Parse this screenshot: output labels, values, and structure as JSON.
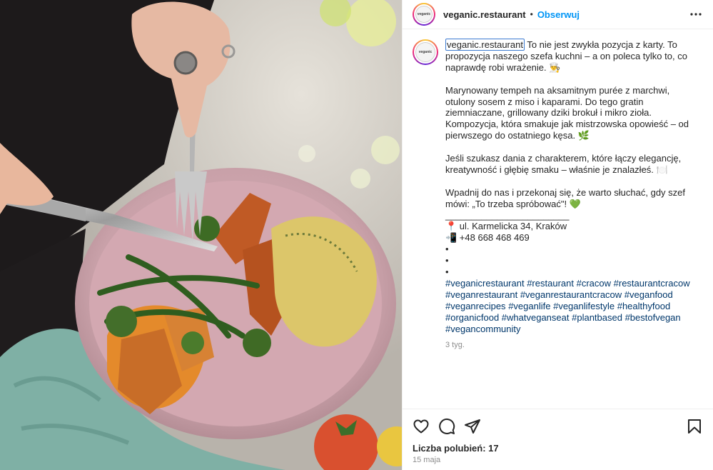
{
  "header": {
    "username": "veganic.restaurant",
    "separator": "•",
    "follow_label": "Obserwuj",
    "avatar_text": "veganic",
    "more_icon": "more-dots-icon"
  },
  "caption": {
    "username": "veganic.restaurant",
    "intro": " To nie jest zwykła pozycja z karty. To propozycja naszego szefa kuchni – a on poleca tylko to, co naprawdę robi wrażenie. 👨‍🍳",
    "para2": "Marynowany tempeh na aksamitnym purée z marchwi, otulony sosem z miso i kaparami. Do tego gratin ziemniaczane, grillowany dziki brokuł i mikro zioła. Kompozycja, która smakuje jak mistrzowska opowieść – od pierwszego do ostatniego kęsa. 🌿",
    "para3": "Jeśli szukasz dania z charakterem, które łączy elegancję, kreatywność i głębię smaku – właśnie je znalazłeś. 🍽️",
    "para4": "Wpadnij do nas i przekonaj się, że warto słuchać, gdy szef mówi: „To trzeba spróbować\"! 💚",
    "divider": "________________________",
    "address": "📍 ul. Karmelicka 34, Kraków",
    "phone": "📲 +48 668 468 469",
    "bullet1": "•",
    "bullet2": "•",
    "bullet3": "•",
    "hashtags": [
      "#veganicrestaurant",
      "#restaurant",
      "#cracow",
      "#restaurantcracow",
      "#veganrestaurant",
      "#veganrestaurantcracow",
      "#veganfood",
      "#veganrecipes",
      "#veganlife",
      "#veganlifestyle",
      "#healthyfood",
      "#organicfood",
      "#whatveganseat",
      "#plantbased",
      "#bestofvegan",
      "#vegancommunity"
    ],
    "time_ago": "3 tyg."
  },
  "actions": {
    "like_icon": "heart-icon",
    "comment_icon": "comment-icon",
    "share_icon": "share-icon",
    "save_icon": "bookmark-icon",
    "likes_text": "Liczba polubień: 17",
    "date": "15 maja"
  },
  "colors": {
    "link": "#00376b",
    "follow": "#0095f6",
    "muted": "#8e8e8e"
  }
}
